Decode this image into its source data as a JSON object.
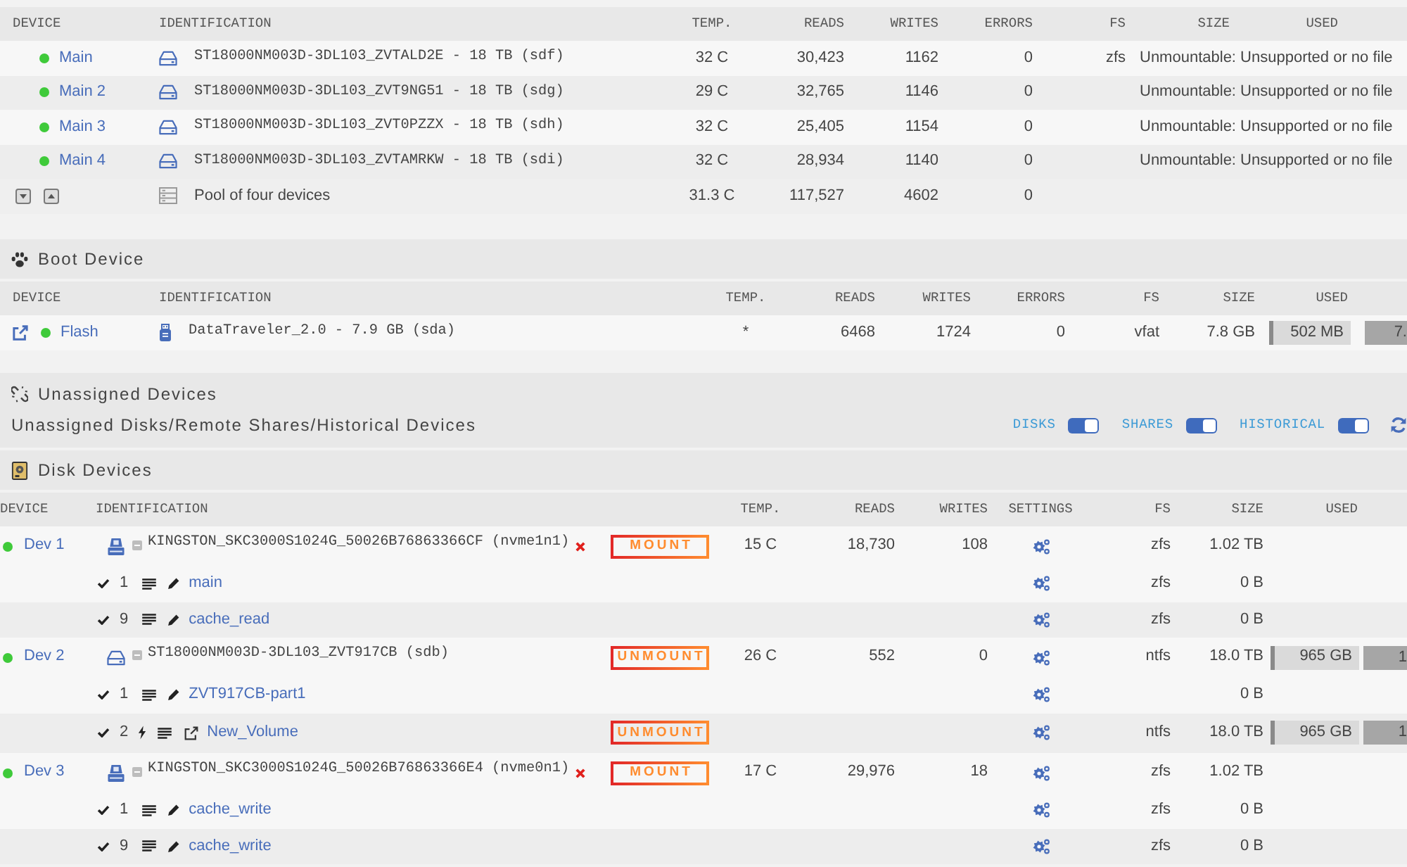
{
  "array_devices": {
    "columns": [
      "DEVICE",
      "IDENTIFICATION",
      "TEMP.",
      "READS",
      "WRITES",
      "ERRORS",
      "FS",
      "SIZE",
      "USED"
    ],
    "rows": [
      {
        "kind": "disk",
        "device": "Main",
        "online": true,
        "identification": "ST18000NM003D-3DL103_ZVTALD2E - 18 TB (sdf)",
        "temp": "32 C",
        "reads": "30,423",
        "writes": "1162",
        "errors": "0",
        "fs": "zfs",
        "note": "Unmountable: Unsupported or no file"
      },
      {
        "kind": "disk",
        "device": "Main 2",
        "online": true,
        "identification": "ST18000NM003D-3DL103_ZVT9NG51 - 18 TB (sdg)",
        "temp": "29 C",
        "reads": "32,765",
        "writes": "1146",
        "errors": "0",
        "note": "Unmountable: Unsupported or no file"
      },
      {
        "kind": "disk",
        "device": "Main 3",
        "online": true,
        "identification": "ST18000NM003D-3DL103_ZVT0PZZX - 18 TB (sdh)",
        "temp": "32 C",
        "reads": "25,405",
        "writes": "1154",
        "errors": "0",
        "note": "Unmountable: Unsupported or no file"
      },
      {
        "kind": "disk",
        "device": "Main 4",
        "online": true,
        "identification": "ST18000NM003D-3DL103_ZVTAMRKW - 18 TB (sdi)",
        "temp": "32 C",
        "reads": "28,934",
        "writes": "1140",
        "errors": "0",
        "note": "Unmountable: Unsupported or no file"
      },
      {
        "kind": "total",
        "identification": "Pool of four devices",
        "temp": "31.3 C",
        "reads": "117,527",
        "writes": "4602",
        "errors": "0"
      }
    ]
  },
  "boot_device": {
    "title": "Boot Device",
    "columns": [
      "DEVICE",
      "IDENTIFICATION",
      "TEMP.",
      "READS",
      "WRITES",
      "ERRORS",
      "FS",
      "SIZE",
      "USED"
    ],
    "rows": [
      {
        "device": "Flash",
        "online": true,
        "identification": "DataTraveler_2.0 - 7.9 GB (sda)",
        "temp": "*",
        "reads": "6468",
        "writes": "1724",
        "errors": "0",
        "fs": "vfat",
        "size": "7.8 GB",
        "used": {
          "text": "502 MB",
          "level": 0.05
        },
        "column_10": "7."
      }
    ]
  },
  "unassigned_devices": {
    "title": "Unassigned Devices",
    "subtitle": "Unassigned Disks/Remote Shares/Historical Devices",
    "toggles": [
      {
        "label": "DISKS",
        "on": true
      },
      {
        "label": "SHARES",
        "on": true
      },
      {
        "label": "HISTORICAL",
        "on": true
      }
    ]
  },
  "disk_devices": {
    "title": "Disk Devices",
    "columns": [
      "DEVICE",
      "IDENTIFICATION",
      "TEMP.",
      "READS",
      "WRITES",
      "SETTINGS",
      "FS",
      "SIZE",
      "USED"
    ],
    "devices": [
      {
        "kind": "ssd",
        "device": "Dev 1",
        "online": true,
        "identification": "KINGSTON_SKC3000S1024G_50026B76863366CF (nvme1n1)",
        "x_mark": true,
        "button": "MOUNT",
        "temp": "15 C",
        "reads": "18,730",
        "writes": "108",
        "fs": "zfs",
        "size": "1.02 TB",
        "children": [
          {
            "checked": true,
            "number": "1",
            "bolt": false,
            "mounted": false,
            "name": "main",
            "fs": "zfs",
            "size": "0 B"
          },
          {
            "checked": true,
            "number": "9",
            "bolt": false,
            "mounted": false,
            "name": "cache_read",
            "fs": "zfs",
            "size": "0 B"
          }
        ]
      },
      {
        "kind": "hdd",
        "device": "Dev 2",
        "online": true,
        "identification": "ST18000NM003D-3DL103_ZVT917CB (sdb)",
        "x_mark": false,
        "button": "UNMOUNT",
        "temp": "26 C",
        "reads": "552",
        "writes": "0",
        "fs": "ntfs",
        "size": "18.0 TB",
        "used": {
          "text": "965 GB",
          "level": 0.05
        },
        "column_10": "1",
        "children": [
          {
            "checked": true,
            "number": "1",
            "bolt": false,
            "mounted": false,
            "name": "ZVT917CB-part1",
            "size": "0 B"
          },
          {
            "checked": true,
            "number": "2",
            "bolt": true,
            "mounted": true,
            "name": "New_Volume",
            "button": "UNMOUNT",
            "fs": "ntfs",
            "size": "18.0 TB",
            "used": {
              "text": "965 GB",
              "level": 0.05
            },
            "column_10": "1"
          }
        ]
      },
      {
        "kind": "ssd",
        "device": "Dev 3",
        "online": true,
        "identification": "KINGSTON_SKC3000S1024G_50026B76863366E4 (nvme0n1)",
        "x_mark": true,
        "button": "MOUNT",
        "temp": "17 C",
        "reads": "29,976",
        "writes": "18",
        "fs": "zfs",
        "size": "1.02 TB",
        "children": [
          {
            "checked": true,
            "number": "1",
            "bolt": false,
            "mounted": false,
            "name": "cache_write",
            "fs": "zfs",
            "size": "0 B"
          },
          {
            "checked": true,
            "number": "9",
            "bolt": false,
            "mounted": false,
            "name": "cache_write",
            "fs": "zfs",
            "size": "0 B"
          }
        ]
      }
    ]
  }
}
